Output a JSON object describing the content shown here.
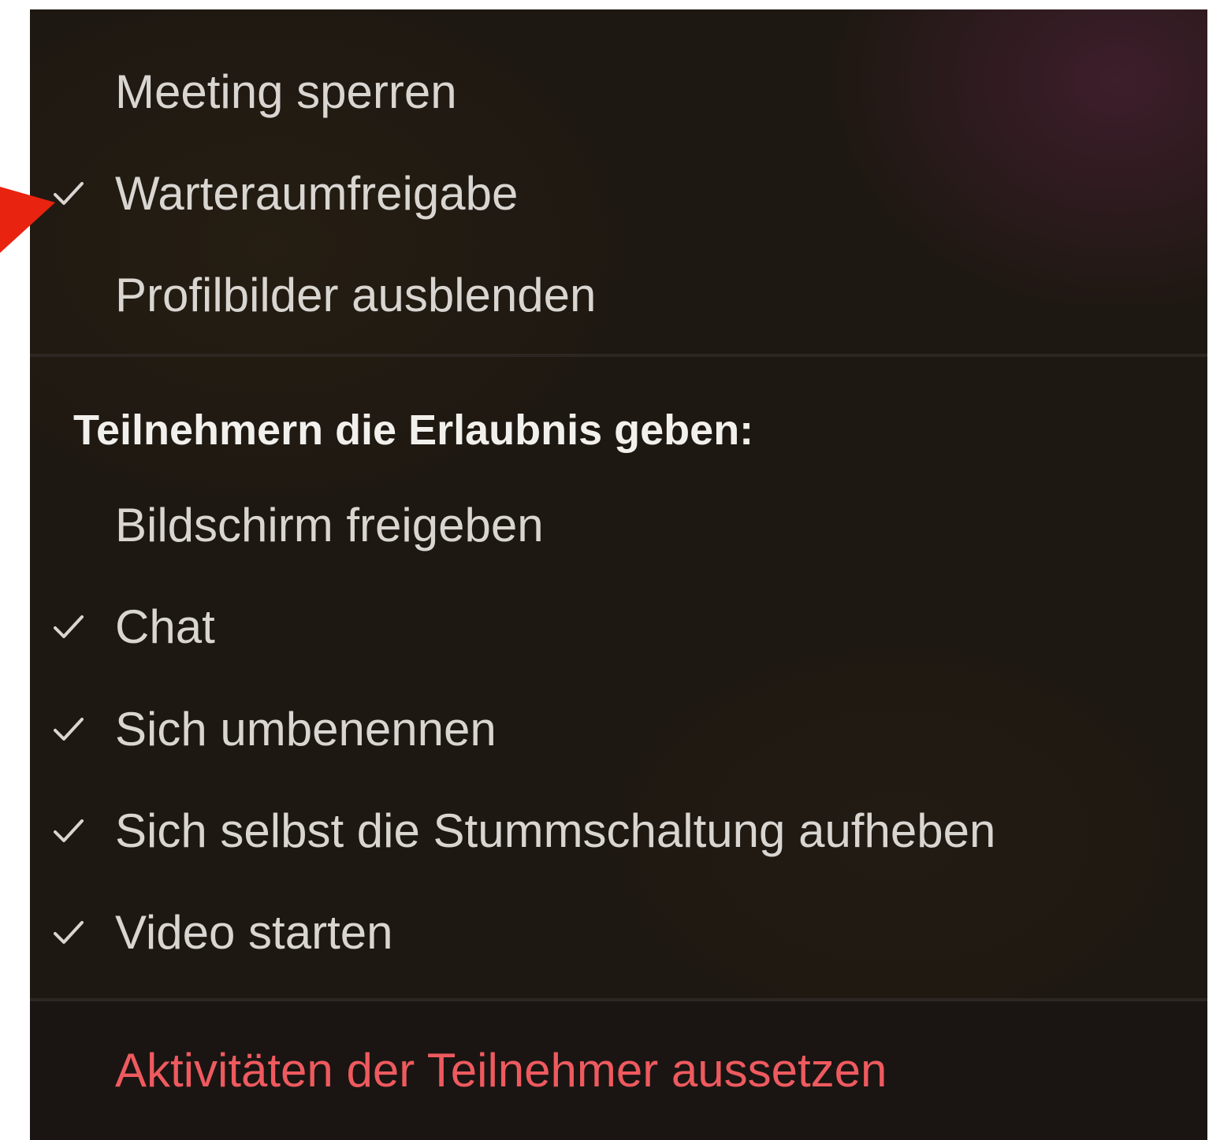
{
  "menu": {
    "top_items": [
      {
        "label": "Meeting sperren",
        "checked": false
      },
      {
        "label": "Warteraumfreigabe",
        "checked": true
      },
      {
        "label": "Profilbilder ausblenden",
        "checked": false
      }
    ],
    "permissions_heading": "Teilnehmern die Erlaubnis geben:",
    "permission_items": [
      {
        "label": "Bildschirm freigeben",
        "checked": false
      },
      {
        "label": "Chat",
        "checked": true
      },
      {
        "label": "Sich umbenennen",
        "checked": true
      },
      {
        "label": "Sich selbst die Stummschaltung aufheben",
        "checked": true
      },
      {
        "label": "Video starten",
        "checked": true
      }
    ],
    "suspend_label": "Aktivitäten der Teilnehmer aussetzen"
  },
  "annotation": {
    "arrow_icon": "arrow-pointer-icon",
    "arrow_color": "#e8230f"
  },
  "colors": {
    "menu_background": "#1e1812",
    "text": "#d9d6d2",
    "heading_text": "#f2f0ec",
    "danger_text": "#ee5a5f"
  }
}
